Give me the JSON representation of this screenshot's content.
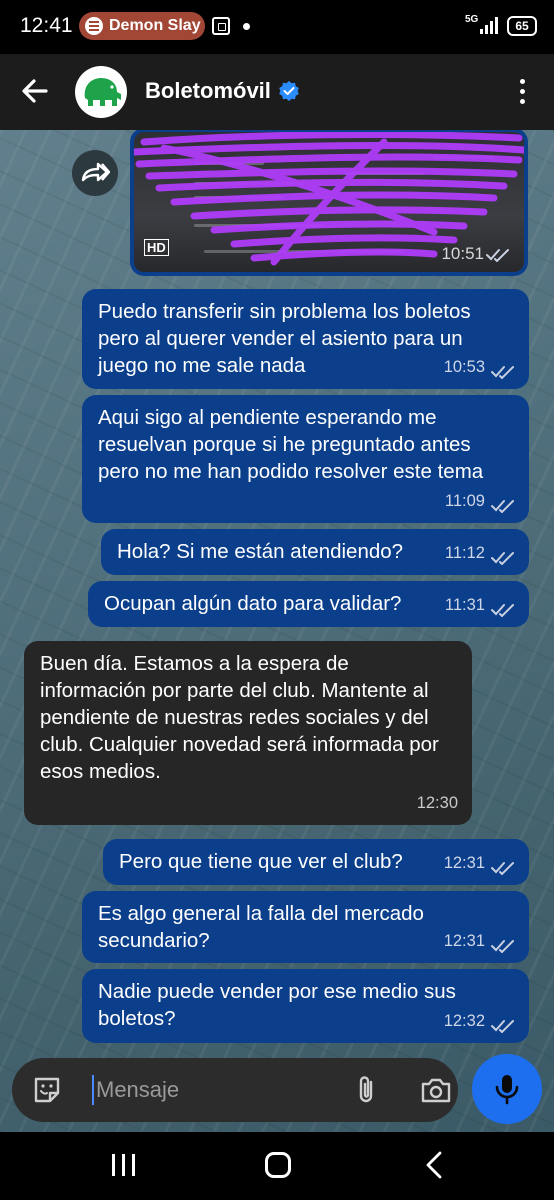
{
  "status_bar": {
    "time": "12:41",
    "media_chip": "Demon Slay",
    "network": "5G",
    "battery": "65"
  },
  "header": {
    "title": "Boletomóvil"
  },
  "image_message": {
    "badge": "HD",
    "time": "10:51"
  },
  "messages": [
    {
      "text": "Puedo transferir sin problema los boletos pero al querer vender el asiento para un juego no me sale nada",
      "time": "10:53",
      "direction": "out"
    },
    {
      "text": "Aqui sigo al pendiente esperando me resuelvan porque si he preguntado antes pero no me han podido resolver este tema",
      "time": "11:09",
      "direction": "out"
    },
    {
      "text": "Hola? Si me están atendiendo?",
      "time": "11:12",
      "direction": "out"
    },
    {
      "text": "Ocupan algún dato para validar?",
      "time": "11:31",
      "direction": "out"
    },
    {
      "text": "Buen día. Estamos a la espera de información por parte del club. Mantente al pendiente de nuestras redes sociales y del club. Cualquier novedad será informada por esos medios.",
      "time": "12:30",
      "direction": "in"
    },
    {
      "text": "Pero que tiene que ver el club?",
      "time": "12:31",
      "direction": "out"
    },
    {
      "text": "Es algo general la falla del mercado secundario?",
      "time": "12:31",
      "direction": "out"
    },
    {
      "text": "Nadie puede vender por ese medio sus boletos?",
      "time": "12:32",
      "direction": "out"
    }
  ],
  "composer": {
    "placeholder": "Mensaje"
  },
  "colors": {
    "outgoing_bubble": "#0b3f8c",
    "incoming_bubble": "#262626",
    "accent": "#1e6ff0",
    "scribble": "#b43cff"
  }
}
